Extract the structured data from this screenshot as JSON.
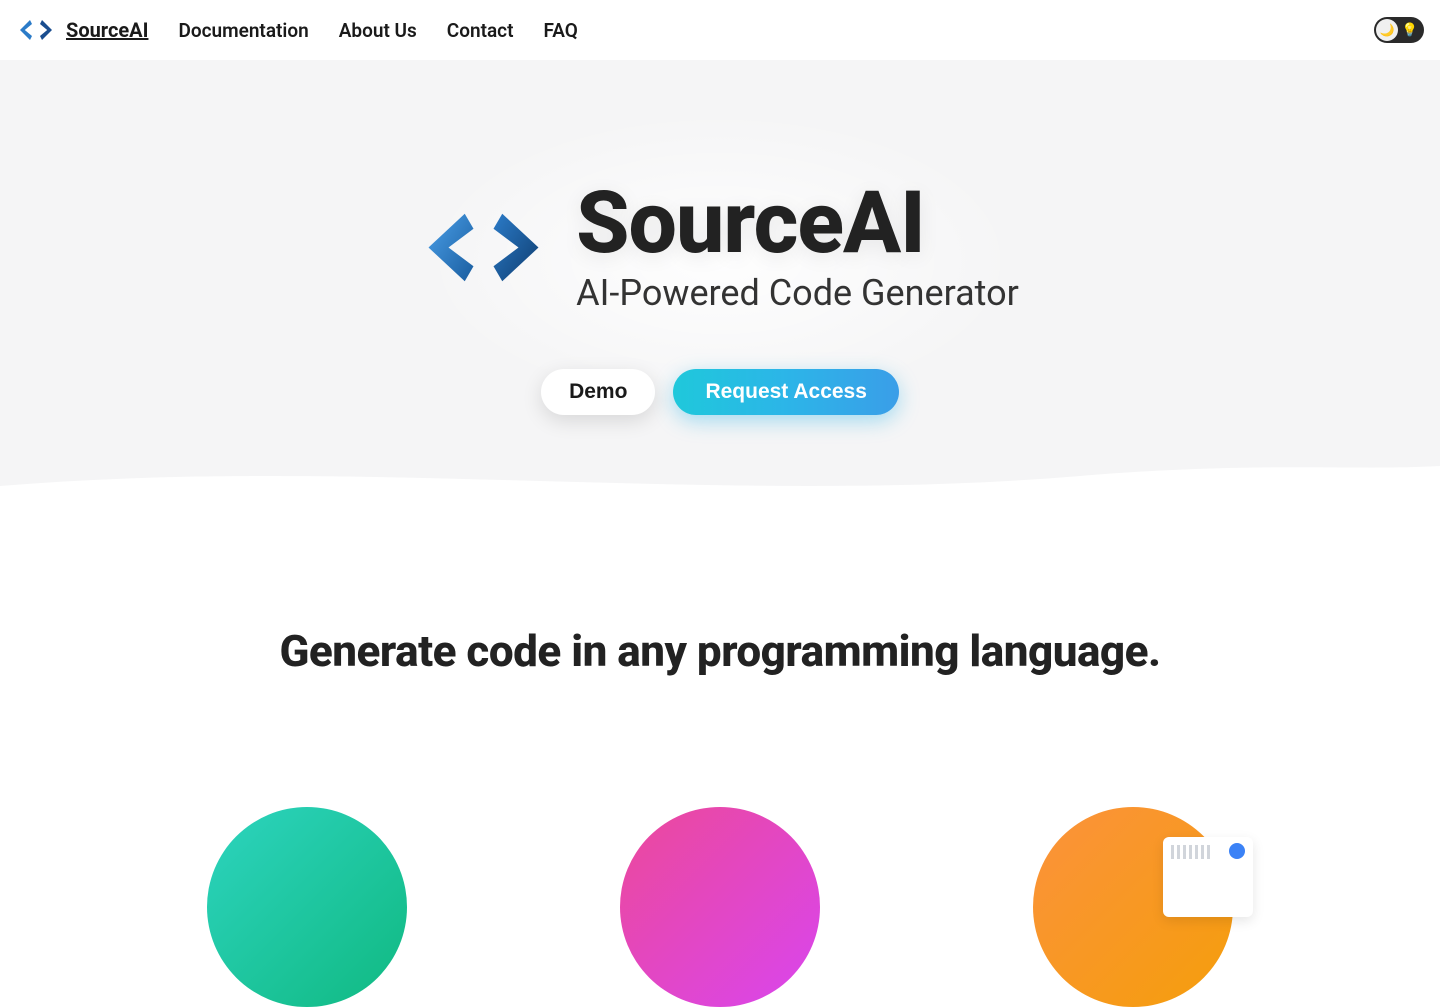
{
  "nav": {
    "brand": "SourceAI",
    "links": [
      "Documentation",
      "About Us",
      "Contact",
      "FAQ"
    ]
  },
  "hero": {
    "title": "SourceAI",
    "subtitle": "AI-Powered Code Generator",
    "demo_label": "Demo",
    "request_label": "Request Access"
  },
  "features": {
    "heading": "Generate code in any programming language."
  },
  "colors": {
    "accent_gradient_start": "#1fc8db",
    "accent_gradient_end": "#3a9ee8",
    "circle1_start": "#2dd4bf",
    "circle2_start": "#ec4899",
    "circle3_start": "#fb923c"
  }
}
